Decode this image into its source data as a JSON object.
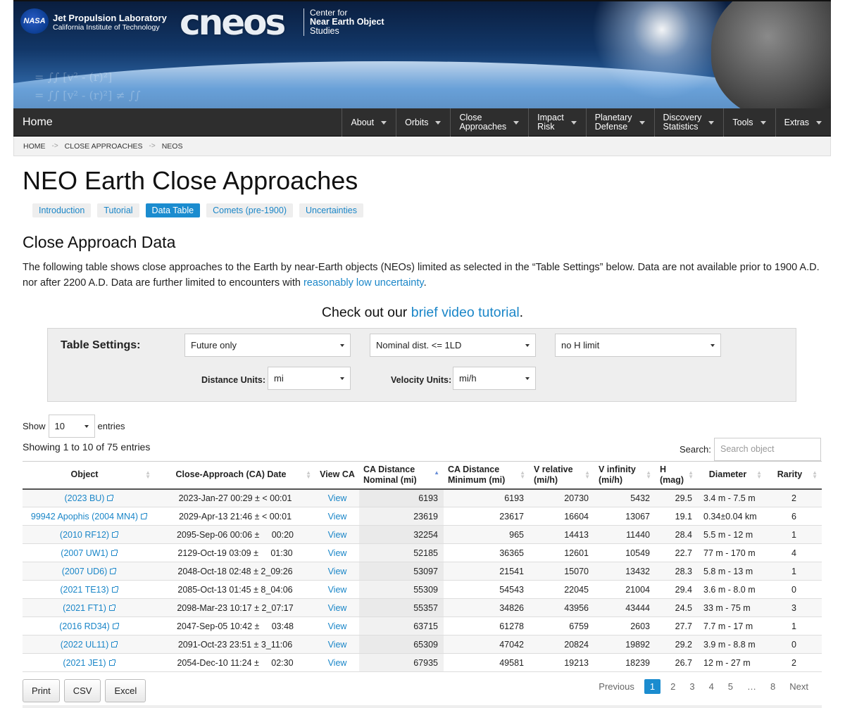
{
  "header": {
    "jpl_name": "Jet Propulsion Laboratory",
    "jpl_sub": "California Institute of Technology",
    "nasa_logo": "NASA",
    "cneos_logo": "cneos",
    "tag_line1": "Center for",
    "tag_line2": "Near Earth Object",
    "tag_line3": "Studies"
  },
  "nav": {
    "home": "Home",
    "items": [
      {
        "label": "About"
      },
      {
        "label": "Orbits"
      },
      {
        "label": "Close\nApproaches"
      },
      {
        "label": "Impact\nRisk"
      },
      {
        "label": "Planetary\nDefense"
      },
      {
        "label": "Discovery\nStatistics"
      },
      {
        "label": "Tools"
      },
      {
        "label": "Extras"
      }
    ]
  },
  "breadcrumb": {
    "home": "HOME",
    "sep": "->",
    "close": "CLOSE APPROACHES",
    "neos": "NEOS"
  },
  "page": {
    "title": "NEO Earth Close Approaches",
    "tabs": [
      "Introduction",
      "Tutorial",
      "Data Table",
      "Comets (pre-1900)",
      "Uncertainties"
    ],
    "section_title": "Close Approach Data",
    "intro_text": "The following table shows close approaches to the Earth by near-Earth objects (NEOs) limited as selected in the “Table Settings” below. Data are not available prior to 1900 A.D. nor after 2200 A.D. Data are further limited to encounters with ",
    "intro_link": "reasonably low uncertainty",
    "intro_end": ".",
    "video_text": "Check out our ",
    "video_link": "brief video tutorial",
    "video_end": "."
  },
  "settings": {
    "label": "Table Settings:",
    "time": "Future only",
    "distance": "Nominal dist. <= 1LD",
    "hlimit": "no H limit",
    "dist_units_label": "Distance Units:",
    "dist_units": "mi",
    "vel_units_label": "Velocity Units:",
    "vel_units": "mi/h"
  },
  "table_controls": {
    "show": "Show",
    "length": "10",
    "entries": "entries",
    "info": "Showing 1 to 10 of 75 entries",
    "search_label": "Search:",
    "search_placeholder": "Search object"
  },
  "table": {
    "headers": [
      "Object",
      "Close-Approach (CA) Date",
      "View CA",
      "CA Distance Nominal (mi)",
      "CA Distance Minimum (mi)",
      "V relative (mi/h)",
      "V infinity (mi/h)",
      "H (mag)",
      "Diameter",
      "Rarity"
    ],
    "rows": [
      {
        "object": "(2023 BU)",
        "date": "2023-Jan-27 00:29 ± < 00:01",
        "view": "View",
        "nominal": "6193",
        "minimum": "6193",
        "vrel": "20730",
        "vinf": "5432",
        "h": "29.5",
        "diameter": "3.4 m - 7.5 m",
        "rarity": "2"
      },
      {
        "object": "99942 Apophis (2004 MN4)",
        "date": "2029-Apr-13 21:46 ± < 00:01",
        "view": "View",
        "nominal": "23619",
        "minimum": "23617",
        "vrel": "16604",
        "vinf": "13067",
        "h": "19.1",
        "diameter": "0.34±0.04 km",
        "rarity": "6"
      },
      {
        "object": "(2010 RF12)",
        "date": "2095-Sep-06 00:06 ±     00:20",
        "view": "View",
        "nominal": "32254",
        "minimum": "965",
        "vrel": "14413",
        "vinf": "11440",
        "h": "28.4",
        "diameter": "5.5 m - 12 m",
        "rarity": "1"
      },
      {
        "object": "(2007 UW1)",
        "date": "2129-Oct-19 03:09 ±     01:30",
        "view": "View",
        "nominal": "52185",
        "minimum": "36365",
        "vrel": "12601",
        "vinf": "10549",
        "h": "22.7",
        "diameter": "77 m - 170 m",
        "rarity": "4"
      },
      {
        "object": "(2007 UD6)",
        "date": "2048-Oct-18 02:48 ± 2_09:26",
        "view": "View",
        "nominal": "53097",
        "minimum": "21541",
        "vrel": "15070",
        "vinf": "13432",
        "h": "28.3",
        "diameter": "5.8 m - 13 m",
        "rarity": "1"
      },
      {
        "object": "(2021 TE13)",
        "date": "2085-Oct-13 01:45 ± 8_04:06",
        "view": "View",
        "nominal": "55309",
        "minimum": "54543",
        "vrel": "22045",
        "vinf": "21004",
        "h": "29.4",
        "diameter": "3.6 m - 8.0 m",
        "rarity": "0"
      },
      {
        "object": "(2021 FT1)",
        "date": "2098-Mar-23 10:17 ± 2_07:17",
        "view": "View",
        "nominal": "55357",
        "minimum": "34826",
        "vrel": "43956",
        "vinf": "43444",
        "h": "24.5",
        "diameter": "33 m - 75 m",
        "rarity": "3"
      },
      {
        "object": "(2016 RD34)",
        "date": "2047-Sep-05 10:42 ±     03:48",
        "view": "View",
        "nominal": "63715",
        "minimum": "61278",
        "vrel": "6759",
        "vinf": "2603",
        "h": "27.7",
        "diameter": "7.7 m - 17 m",
        "rarity": "1"
      },
      {
        "object": "(2022 UL11)",
        "date": "2091-Oct-23 23:51 ± 3_11:06",
        "view": "View",
        "nominal": "65309",
        "minimum": "47042",
        "vrel": "20824",
        "vinf": "19892",
        "h": "29.2",
        "diameter": "3.9 m - 8.8 m",
        "rarity": "0"
      },
      {
        "object": "(2021 JE1)",
        "date": "2054-Dec-10 11:24 ±     02:30",
        "view": "View",
        "nominal": "67935",
        "minimum": "49581",
        "vrel": "19213",
        "vinf": "18239",
        "h": "26.7",
        "diameter": "12 m - 27 m",
        "rarity": "2"
      }
    ]
  },
  "export": {
    "print": "Print",
    "csv": "CSV",
    "excel": "Excel"
  },
  "pager": {
    "previous": "Previous",
    "pages": [
      "1",
      "2",
      "3",
      "4",
      "5",
      "…",
      "8"
    ],
    "next": "Next"
  },
  "colors": {
    "link": "#1a86c8",
    "active_tab": "#1b8ccf",
    "nav_bg": "#2e2e2e"
  }
}
